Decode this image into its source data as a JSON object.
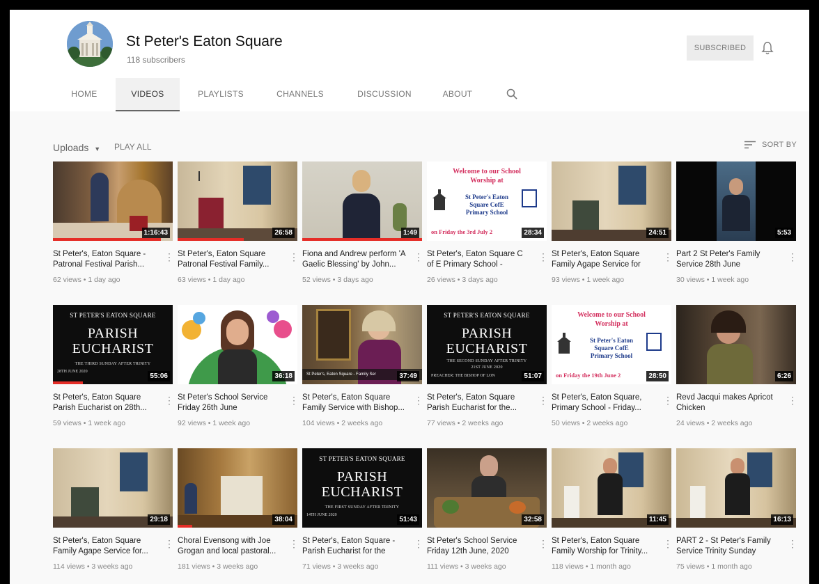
{
  "channel": {
    "name": "St Peter's Eaton Square",
    "subscribers": "118 subscribers",
    "subscribe_label": "SUBSCRIBED"
  },
  "tabs": [
    "HOME",
    "VIDEOS",
    "PLAYLISTS",
    "CHANNELS",
    "DISCUSSION",
    "ABOUT"
  ],
  "active_tab": "VIDEOS",
  "toolbar": {
    "uploads_label": "Uploads",
    "play_all_label": "PLAY ALL",
    "sort_label": "SORT BY"
  },
  "thumb_text": {
    "parish_line1": "ST PETER'S EATON SQUARE",
    "parish_line2": "PARISH",
    "parish_line3": "EUCHARIST",
    "pe7_sub": "THE THIRD SUNDAY AFTER TRINITY",
    "pe7_date": "28TH JUNE 2020",
    "pe10_sub": "THE SECOND SUNDAY AFTER TRINITY",
    "pe10_date": "21ST JUNE 2020",
    "pe10_preacher": "PREACHER: THE BISHOP OF LON",
    "pe15_sub": "THE FIRST SUNDAY AFTER TRINITY",
    "pe15_date": "14TH JUNE 2020",
    "welcome": "Welcome to our School Worship at",
    "school": "St Peter's Eaton Square CofE Primary School",
    "school_short": "St Peter's Eaton Square CofE Primary School",
    "date_3july": "on Friday the 3rd July 2",
    "date_19june": "on Friday the 19th June 2",
    "bishop_caption": "St Peter's, Eaton Square - Family Ser"
  },
  "videos": [
    {
      "title": "St Peter's, Eaton Square - Patronal Festival Parish...",
      "meta": "62 views • 1 day ago",
      "duration": "1:16:43",
      "progress": 0.9
    },
    {
      "title": "St Peter's, Eaton Square Patronal Festival Family...",
      "meta": "63 views • 1 day ago",
      "duration": "26:58",
      "progress": 0.55
    },
    {
      "title": "Fiona and Andrew perform 'A Gaelic Blessing' by John...",
      "meta": "52 views • 3 days ago",
      "duration": "1:49",
      "progress": 1.0
    },
    {
      "title": "St Peter's, Eaton Square C of E Primary School - Friday...",
      "meta": "26 views • 3 days ago",
      "duration": "28:34",
      "progress": 0
    },
    {
      "title": "St Peter's, Eaton Square Family Agape Service for th...",
      "meta": "93 views • 1 week ago",
      "duration": "24:51",
      "progress": 0
    },
    {
      "title": "Part 2 St Peter's Family Service 28th June",
      "meta": "30 views • 1 week ago",
      "duration": "5:53",
      "progress": 0
    },
    {
      "title": "St Peter's, Eaton Square Parish Eucharist on 28th...",
      "meta": "59 views • 1 week ago",
      "duration": "55:06",
      "progress": 0.25
    },
    {
      "title": "St Peter's School Service Friday 26th June",
      "meta": "92 views • 1 week ago",
      "duration": "36:18",
      "progress": 0
    },
    {
      "title": "St Peter's, Eaton Square Family Service with Bishop...",
      "meta": "104 views • 2 weeks ago",
      "duration": "37:49",
      "progress": 0
    },
    {
      "title": "St Peter's, Eaton Square Parish Eucharist for the...",
      "meta": "77 views • 2 weeks ago",
      "duration": "51:07",
      "progress": 0
    },
    {
      "title": "St Peter's, Eaton Square, Primary School - Friday...",
      "meta": "50 views • 2 weeks ago",
      "duration": "28:50",
      "progress": 0
    },
    {
      "title": "Revd Jacqui makes Apricot Chicken",
      "meta": "24 views • 2 weeks ago",
      "duration": "6:26",
      "progress": 0
    },
    {
      "title": "St Peter's, Eaton Square Family Agape Service for...",
      "meta": "114 views • 3 weeks ago",
      "duration": "29:18",
      "progress": 0
    },
    {
      "title": "Choral Evensong with Joe Grogan and local pastoral...",
      "meta": "181 views • 3 weeks ago",
      "duration": "38:04",
      "progress": 0.12
    },
    {
      "title": "St Peter's, Eaton Square - Parish Eucharist for the first...",
      "meta": "71 views • 3 weeks ago",
      "duration": "51:43",
      "progress": 0
    },
    {
      "title": "St Peter's School Service Friday 12th June, 2020",
      "meta": "111 views • 3 weeks ago",
      "duration": "32:58",
      "progress": 0
    },
    {
      "title": "St Peter's, Eaton Square Family Worship for Trinity...",
      "meta": "118 views • 1 month ago",
      "duration": "11:45",
      "progress": 0
    },
    {
      "title": "PART 2 - St Peter's Family Service Trinity Sunday",
      "meta": "75 views • 1 month ago",
      "duration": "16:13",
      "progress": 0
    }
  ]
}
